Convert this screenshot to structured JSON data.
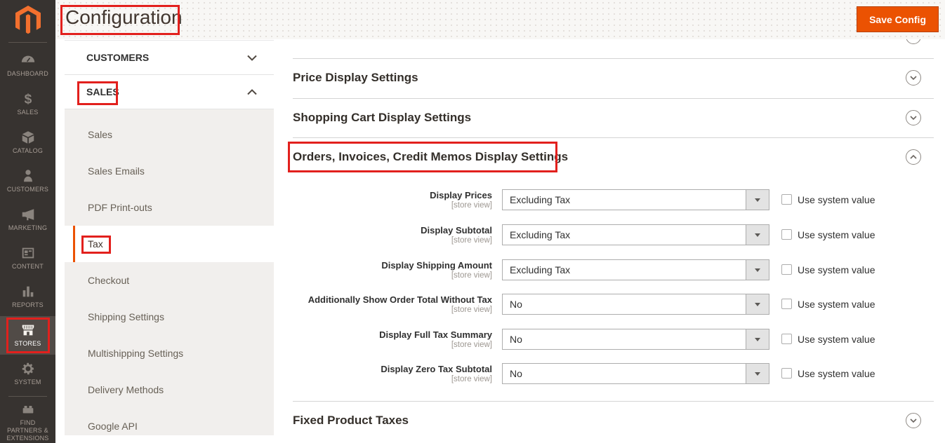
{
  "header": {
    "title": "Configuration",
    "save_button": "Save Config"
  },
  "appnav": {
    "active": "STORES",
    "items": [
      {
        "label": "DASHBOARD",
        "icon": "dashboard-icon"
      },
      {
        "label": "SALES",
        "icon": "dollar-icon"
      },
      {
        "label": "CATALOG",
        "icon": "catalog-box-icon"
      },
      {
        "label": "CUSTOMERS",
        "icon": "customer-icon"
      },
      {
        "label": "MARKETING",
        "icon": "megaphone-icon"
      },
      {
        "label": "CONTENT",
        "icon": "content-layout-icon"
      },
      {
        "label": "REPORTS",
        "icon": "bar-chart-icon"
      },
      {
        "label": "STORES",
        "icon": "storefront-icon"
      },
      {
        "label": "SYSTEM",
        "icon": "gear-icon"
      },
      {
        "label": "FIND PARTNERS & EXTENSIONS",
        "icon": "extensions-puzzle-icon"
      }
    ]
  },
  "confignav": {
    "customers_label": "CUSTOMERS",
    "sales_label": "SALES",
    "active_item": "Tax",
    "items": [
      "Sales",
      "Sales Emails",
      "PDF Print-outs",
      "Tax",
      "Checkout",
      "Shipping Settings",
      "Multishipping Settings",
      "Delivery Methods",
      "Google API"
    ]
  },
  "content": {
    "sections": {
      "price": "Price Display Settings",
      "cart": "Shopping Cart Display Settings",
      "orders": "Orders, Invoices, Credit Memos Display Settings",
      "fpt": "Fixed Product Taxes"
    },
    "scope_note": "[store view]",
    "use_system_value": "Use system value",
    "rows": [
      {
        "label": "Display Prices",
        "value": "Excluding Tax"
      },
      {
        "label": "Display Subtotal",
        "value": "Excluding Tax"
      },
      {
        "label": "Display Shipping Amount",
        "value": "Excluding Tax"
      },
      {
        "label": "Additionally Show Order Total Without Tax",
        "value": "No"
      },
      {
        "label": "Display Full Tax Summary",
        "value": "No"
      },
      {
        "label": "Display Zero Tax Subtotal",
        "value": "No"
      }
    ]
  },
  "colors": {
    "brand_orange": "#eb5202",
    "logo_orange": "#f3702e",
    "sidebar_bg": "#373330",
    "sidebar_active_bg": "#514b47",
    "annotation_red": "#e2201d",
    "subnav_bg": "#f1efed"
  }
}
